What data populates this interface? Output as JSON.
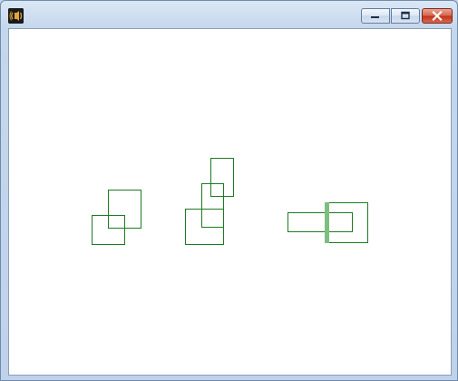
{
  "window": {
    "title": "",
    "controls": {
      "minimize_icon": "minimize-icon",
      "maximize_icon": "maximize-icon",
      "close_icon": "close-icon"
    }
  },
  "colors": {
    "outline": "#1e7a22",
    "highlight": "#7dbf7e",
    "close_button": "#c2351b",
    "client_background": "#ffffff"
  },
  "canvas": {
    "groups": [
      {
        "name": "two-overlapping-squares"
      },
      {
        "name": "three-stacked-rectangles"
      },
      {
        "name": "horizontal-pair-with-bar"
      }
    ]
  }
}
